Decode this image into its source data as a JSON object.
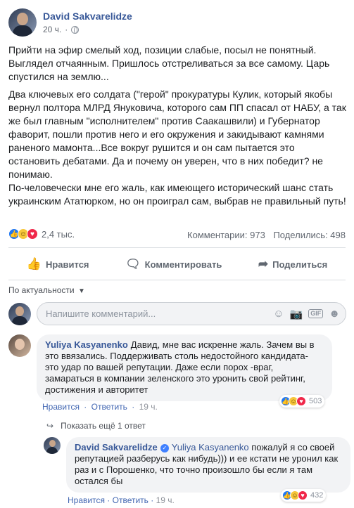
{
  "post": {
    "author": "David Sakvarelidze",
    "time": "20 ч.",
    "paragraph1": "Прийти на эфир смелый ход, позиции слабые, посыл не понятный. Выглядел отчаянным. Пришлось отстреливаться за все самому. Царь спустился на землю...",
    "paragraph2": "Два ключевых его солдата (\"герой\" прокуратуры Кулик, который якобы вернул полтора МЛРД Януковича, которого сам ПП спасал от НАБУ, а так же был главным \"исполнителем\" против Саакашвили) и Губернатор фаворит, пошли против него и его окружения и закидывают камнями раненого мамонта...Все вокруг рушится и он сам пытается это остановить дебатами. Да и почему он уверен, что в них победит? не понимаю.",
    "paragraph3": "По-человечески мне его жаль, как имеющего исторический шанс стать украинским Ататюрком, но он проиграл сам, выбрав не правильный путь!",
    "reaction_count": "2,4 тыс.",
    "comments_stat": "Комментарии: 973",
    "shares_stat": "Поделились: 498"
  },
  "actions": {
    "like": "Нравится",
    "comment": "Комментировать",
    "share": "Поделиться"
  },
  "sort_label": "По актуальности",
  "composer": {
    "placeholder": "Напишите комментарий...",
    "gif_label": "GIF"
  },
  "comment": {
    "author": "Yuliya Kasyanenko",
    "text": "Давид, мне вас искренне жаль. Зачем вы в это ввязались. Поддерживать столь недостойного кандидата- это удар по вашей репутации. Даже если порох -враг, замараться в компании зеленского это уронить свой рейтинг, достижения и авторитет",
    "like_link": "Нравится",
    "reply_link": "Ответить",
    "time": "19 ч.",
    "reactions": "503"
  },
  "more_replies": "Показать ещё 1 ответ",
  "reply": {
    "author": "David Sakvarelidze",
    "mention": "Yuliya Kasyanenko",
    "text": " пожалуй я со своей репутацией разберусь как нибудь))) и ее кстати не уронил как раз и с Порошенко, что точно произошло бы если я там остался бы",
    "like_link": "Нравится",
    "reply_link": "Ответить",
    "time": "19 ч.",
    "reactions": "432"
  },
  "colors": {
    "link": "#385898",
    "like": "#2078f4",
    "love": "#f0284a",
    "haha": "#f7c63b"
  }
}
